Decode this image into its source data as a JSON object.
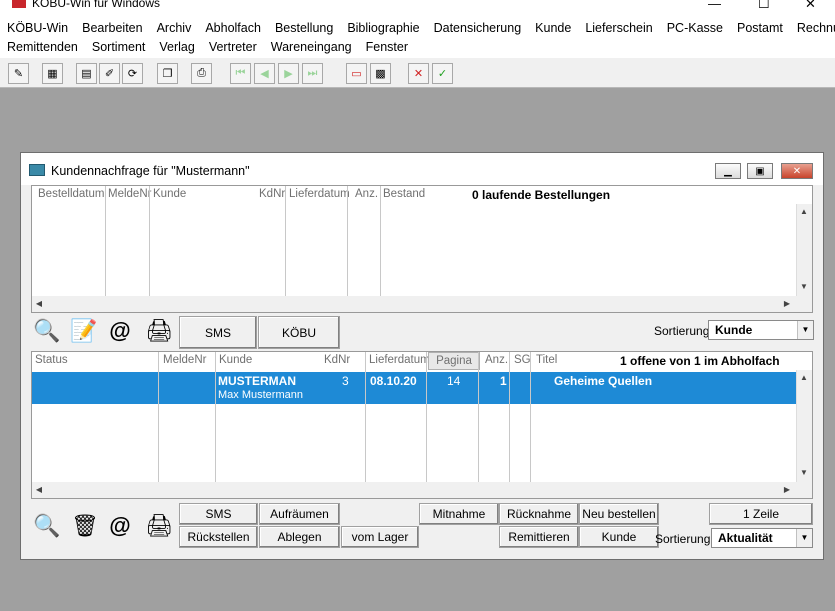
{
  "app": {
    "title": "KÖBU-Win für Windows"
  },
  "menu": {
    "row1": [
      "KÖBU-Win",
      "Bearbeiten",
      "Archiv",
      "Abholfach",
      "Bestellung",
      "Bibliographie",
      "Datensicherung",
      "Kunde",
      "Lieferschein",
      "PC-Kasse",
      "Postamt",
      "Rechnung"
    ],
    "row2": [
      "Remittenden",
      "Sortiment",
      "Verlag",
      "Vertreter",
      "Wareneingang",
      "Fenster"
    ]
  },
  "window": {
    "title": "Kundennachfrage für \"Mustermann\""
  },
  "orders": {
    "headers": [
      "Bestelldatum",
      "MeldeNr",
      "Kunde",
      "KdNr",
      "Lieferdatum",
      "Anz.",
      "Bestand"
    ],
    "summary": "0 laufende Bestellungen"
  },
  "middle_bar": {
    "sms": "SMS",
    "koebu": "KÖBU",
    "sort_label": "Sortierung",
    "sort_value": "Kunde"
  },
  "pickup": {
    "headers": [
      "Status",
      "MeldeNr",
      "Kunde",
      "KdNr",
      "Lieferdatum",
      "Pagina",
      "Anz.",
      "SG",
      "Titel"
    ],
    "summary": "1 offene von 1 im Abholfach",
    "row": {
      "kunde": "MUSTERMAN",
      "kunde2": "Max Mustermann",
      "kdnr": "3",
      "lieferdatum": "08.10.20",
      "pagina": "14",
      "anz": "1",
      "titel": "Geheime Quellen"
    }
  },
  "bottom_bar": {
    "sms": "SMS",
    "aufraeumen": "Aufräumen",
    "rueckstellen": "Rückstellen",
    "ablegen": "Ablegen",
    "vom_lager": "vom Lager",
    "mitnahme": "Mitnahme",
    "ruecknahme": "Rücknahme",
    "remittieren": "Remittieren",
    "neu_bestellen": "Neu bestellen",
    "kunde": "Kunde",
    "zeile": "1 Zeile",
    "sort_label": "Sortierung",
    "sort_value": "Aktualität"
  }
}
